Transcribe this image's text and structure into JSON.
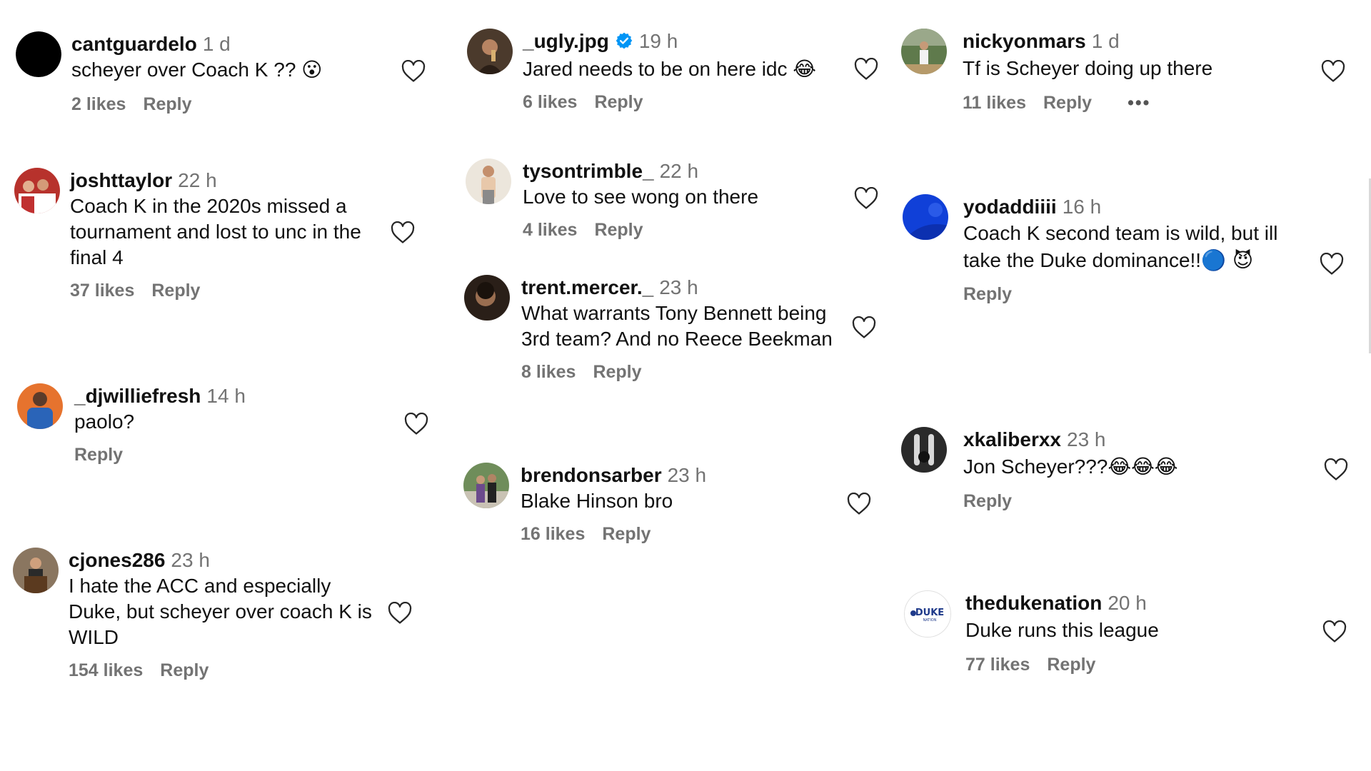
{
  "columns": [
    {
      "comments": [
        {
          "user": "cantguardelo",
          "time": "1 d",
          "text": "scheyer over Coach K ??",
          "emoji": "😮",
          "likes": "2 likes",
          "reply": "Reply"
        },
        {
          "user": "joshttaylor",
          "time": "22 h",
          "text": "Coach K in the 2020s missed a tournament and lost to unc in the final 4",
          "likes": "37 likes",
          "reply": "Reply"
        },
        {
          "user": "_djwilliefresh",
          "time": "14 h",
          "text": "paolo?",
          "reply": "Reply"
        },
        {
          "user": "cjones286",
          "time": "23 h",
          "text": "I hate the ACC and especially Duke, but scheyer over coach K is WILD",
          "likes": "154 likes",
          "reply": "Reply"
        }
      ]
    },
    {
      "comments": [
        {
          "user": "_ugly.jpg",
          "time": "19 h",
          "verified": true,
          "text": "Jared needs to be on here idc",
          "emoji": "😂",
          "likes": "6 likes",
          "reply": "Reply"
        },
        {
          "user": "tysontrimble_",
          "time": "22 h",
          "text": "Love to see wong on there",
          "likes": "4 likes",
          "reply": "Reply"
        },
        {
          "user": "trent.mercer._",
          "time": "23 h",
          "text": "What warrants Tony Bennett being 3rd team? And no Reece Beekman",
          "likes": "8 likes",
          "reply": "Reply"
        },
        {
          "user": "brendonsarber",
          "time": "23 h",
          "text": "Blake Hinson bro",
          "likes": "16 likes",
          "reply": "Reply"
        }
      ]
    },
    {
      "comments": [
        {
          "user": "nickyonmars",
          "time": "1 d",
          "text": "Tf is Scheyer doing up there",
          "likes": "11 likes",
          "reply": "Reply",
          "more": "•••"
        },
        {
          "user": "yodaddiiii",
          "time": "16 h",
          "text": "Coach K second team is wild, but ill take the Duke dominance!!",
          "emoji": "🔵 😈",
          "reply": "Reply"
        },
        {
          "user": "xkaliberxx",
          "time": "23 h",
          "text": "Jon Scheyer???",
          "emoji": "😂😂😂",
          "reply": "Reply"
        },
        {
          "user": "thedukenation",
          "time": "20 h",
          "text": "Duke runs this league",
          "likes": "77 likes",
          "reply": "Reply",
          "avatar_logo": "DUKE",
          "avatar_logo_sub": "NATION"
        }
      ]
    }
  ],
  "colors": {
    "text": "#111111",
    "muted": "#737373",
    "verified": "#0095f6",
    "background": "#ffffff"
  }
}
